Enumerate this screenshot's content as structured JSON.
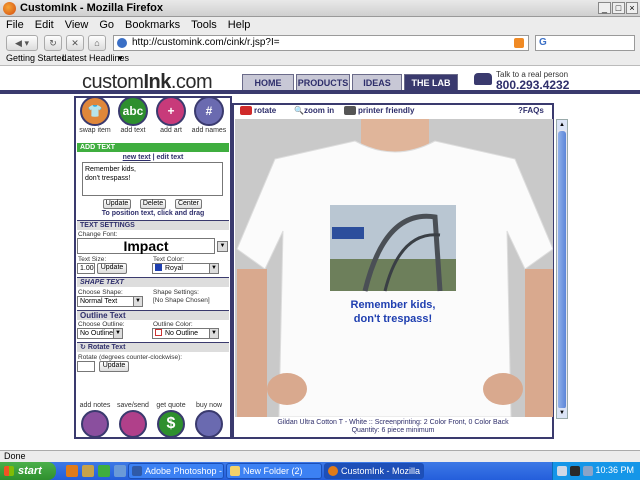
{
  "window": {
    "title": "CustomInk - Mozilla Firefox",
    "icon": "firefox-icon"
  },
  "menu": [
    "File",
    "Edit",
    "View",
    "Go",
    "Bookmarks",
    "Tools",
    "Help"
  ],
  "nav": {
    "url": "http://customink.com/cink/r.jsp?I=",
    "search_placeholder": ""
  },
  "bookmarks": [
    "Getting Started",
    "Latest Headlines"
  ],
  "site": {
    "logo_prefix": "custom",
    "logo_bold": "Ink",
    "logo_suffix": ".com",
    "tabs": [
      "HOME",
      "PRODUCTS",
      "IDEAS",
      "THE LAB"
    ],
    "active_tab": "THE LAB",
    "talk_line": "Talk to a real person",
    "phone": "800.293.4232"
  },
  "tools": [
    {
      "label": "swap item",
      "icon": "shirt-icon"
    },
    {
      "label": "add text",
      "icon": "abc-icon",
      "glyph": "abc"
    },
    {
      "label": "add art",
      "icon": "add-art-icon"
    },
    {
      "label": "add names",
      "icon": "add-names-icon"
    }
  ],
  "add_text": {
    "header": "ADD TEXT",
    "link_new": "new text",
    "link_sep": "|",
    "link_edit": "edit text",
    "text_value": "Remember kids,\ndon't trespass!",
    "buttons": [
      "Update",
      "Delete",
      "Center"
    ],
    "hint": "To position text, click and drag"
  },
  "text_settings": {
    "header": "TEXT SETTINGS",
    "change_font_label": "Change Font:",
    "font": "Impact",
    "text_size_label": "Text Size:",
    "text_size": "1.00",
    "update_label": "Update",
    "text_color_label": "Text Color:",
    "text_color": "Royal",
    "text_color_hex": "#1f3fb0"
  },
  "shape_text": {
    "header": "SHAPE TEXT",
    "choose_shape_label": "Choose Shape:",
    "shape": "Normal Text",
    "shape_settings_label": "Shape Settings:",
    "shape_settings": "[No Shape Chosen]"
  },
  "outline_text": {
    "header": "Outline Text",
    "choose_outline_label": "Choose Outline:",
    "outline": "No Outline",
    "outline_color_label": "Outline Color:",
    "outline_color": "No Outline"
  },
  "rotate_text": {
    "header": "Rotate Text",
    "rotate_label": "Rotate (degrees counter-clockwise):",
    "rotate_value": "",
    "update_label": "Update"
  },
  "actions": [
    {
      "label": "add notes",
      "icon": "notes-icon"
    },
    {
      "label": "save/send",
      "icon": "save-icon"
    },
    {
      "label": "get quote",
      "icon": "dollar-icon"
    },
    {
      "label": "buy now",
      "icon": "cart-icon"
    }
  ],
  "design_toolbar": {
    "rotate": "rotate",
    "zoom": "zoom in",
    "printer": "printer friendly",
    "faqs": "FAQs"
  },
  "design": {
    "shirt_text_line1": "Remember kids,",
    "shirt_text_line2": "don't trespass!",
    "caption_line1": "Gildan Ultra Cotton T - White :: Screenprinting: 2 Color Front, 0 Color Back",
    "caption_line2": "Quantity: 6 piece minimum"
  },
  "status": "Done",
  "taskbar": {
    "start": "start",
    "items": [
      "Adobe Photoshop - [...",
      "New Folder (2)",
      "CustomInk - Mozilla Fi..."
    ],
    "active_index": 2,
    "clock": "10:36 PM"
  }
}
